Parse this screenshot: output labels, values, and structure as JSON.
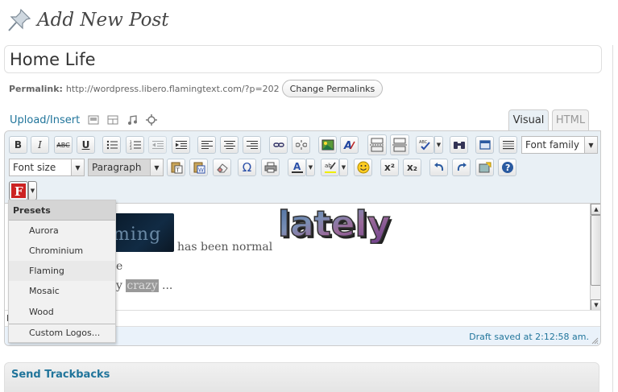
{
  "header": {
    "title": "Add New Post"
  },
  "post": {
    "title_value": "Home Life",
    "permalink_label": "Permalink:",
    "permalink_url": "http://wordpress.libero.flamingtext.com/?p=202",
    "change_permalinks_label": "Change Permalinks"
  },
  "media": {
    "upload_label": "Upload/Insert",
    "icons": [
      "image-icon",
      "video-icon",
      "audio-icon",
      "media-icon"
    ]
  },
  "tabs": {
    "visual": "Visual",
    "html": "HTML"
  },
  "toolbar": {
    "bold": "B",
    "italic": "I",
    "strike": "ABC",
    "underline": "U",
    "font_family": "Font family",
    "font_size": "Font size",
    "format": "Paragraph",
    "omega": "Ω",
    "superscript": "x²",
    "subscript": "x₂"
  },
  "content": {
    "image_text": "ming",
    "line1_after_image": "has been normal",
    "line2": "e",
    "line3_prefix": "y",
    "line3_highlight": "crazy",
    "line3_suffix": "...",
    "logo_text": "lately"
  },
  "path_label": "P",
  "status": {
    "draft_saved": "Draft saved at 2:12:58 am."
  },
  "preset_menu": {
    "header": "Presets",
    "items": [
      "Aurora",
      "Chrominium",
      "Flaming",
      "Mosaic",
      "Wood"
    ],
    "custom": "Custom Logos..."
  },
  "trackbacks": {
    "title": "Send Trackbacks"
  },
  "colors": {
    "link": "#21759b",
    "editor_bg": "#e9f0f5",
    "status_bg": "#eaf2fa",
    "flaming_red": "#cc2222"
  }
}
